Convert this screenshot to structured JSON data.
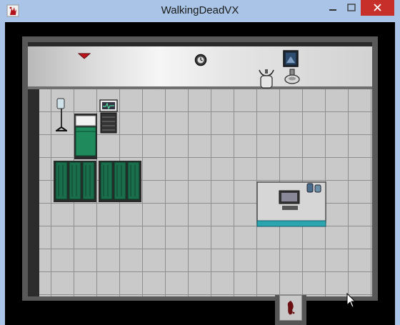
{
  "window": {
    "title": "WalkingDeadVX"
  },
  "colors": {
    "titlebar": "#a9c4e6",
    "close_button": "#c7302a",
    "floor": "#c9c9c9",
    "bed_sheet": "#1f8a5c",
    "screen_curtain": "#1a6e4c",
    "desk_edge": "#2aa6b0"
  },
  "icons": {
    "app": "bloody-hand-icon",
    "minimize": "minimize-icon",
    "maximize": "maximize-icon",
    "close": "close-icon"
  }
}
